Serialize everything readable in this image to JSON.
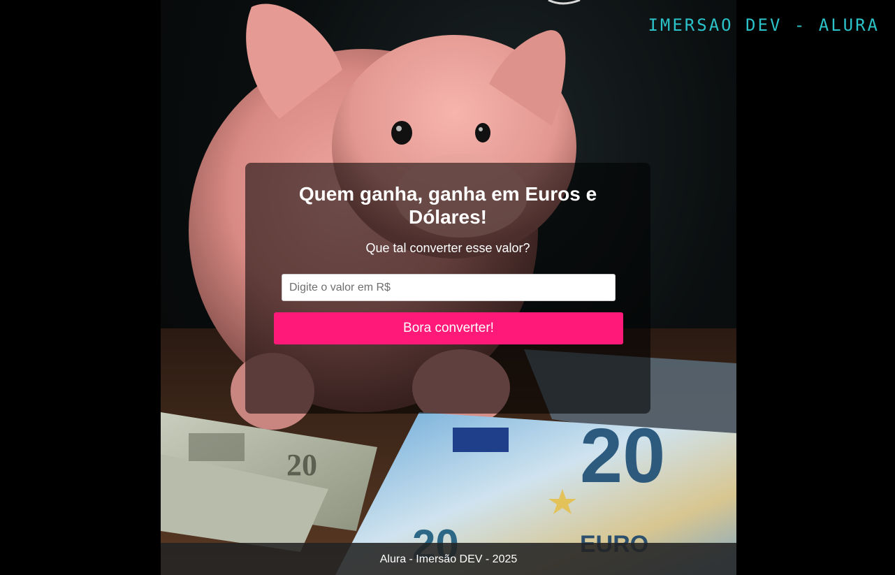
{
  "header": {
    "logo_text": "IMERSAO DEV - ALURA"
  },
  "converter": {
    "title": "Quem ganha, ganha em Euros e Dólares!",
    "subtitle": "Que tal converter esse valor?",
    "input_placeholder": "Digite o valor em R$",
    "input_value": "",
    "button_label": "Bora converter!"
  },
  "footer": {
    "text": "Alura - Imersão DEV - 2025"
  },
  "colors": {
    "accent_button": "#ff1a7a",
    "logo": "#2bc3c9",
    "background": "#000000"
  },
  "background_image": {
    "euro_note_value": "20",
    "euro_note_label": "EURO",
    "dollar_note_value": "20"
  }
}
